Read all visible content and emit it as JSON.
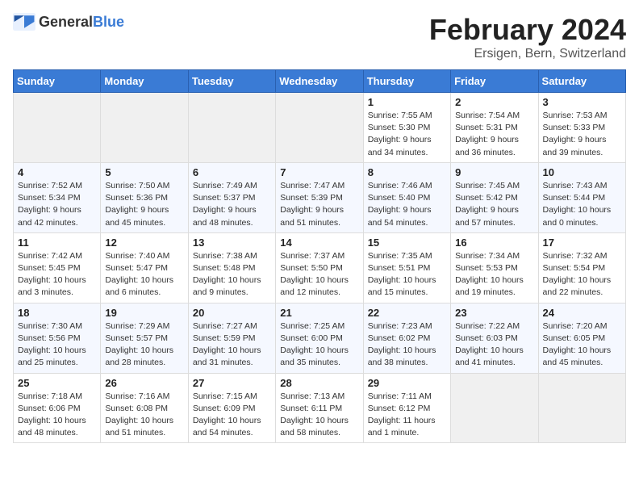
{
  "header": {
    "logo_general": "General",
    "logo_blue": "Blue",
    "month": "February 2024",
    "location": "Ersigen, Bern, Switzerland"
  },
  "weekdays": [
    "Sunday",
    "Monday",
    "Tuesday",
    "Wednesday",
    "Thursday",
    "Friday",
    "Saturday"
  ],
  "weeks": [
    [
      {
        "day": "",
        "info": ""
      },
      {
        "day": "",
        "info": ""
      },
      {
        "day": "",
        "info": ""
      },
      {
        "day": "",
        "info": ""
      },
      {
        "day": "1",
        "info": "Sunrise: 7:55 AM\nSunset: 5:30 PM\nDaylight: 9 hours and 34 minutes."
      },
      {
        "day": "2",
        "info": "Sunrise: 7:54 AM\nSunset: 5:31 PM\nDaylight: 9 hours and 36 minutes."
      },
      {
        "day": "3",
        "info": "Sunrise: 7:53 AM\nSunset: 5:33 PM\nDaylight: 9 hours and 39 minutes."
      }
    ],
    [
      {
        "day": "4",
        "info": "Sunrise: 7:52 AM\nSunset: 5:34 PM\nDaylight: 9 hours and 42 minutes."
      },
      {
        "day": "5",
        "info": "Sunrise: 7:50 AM\nSunset: 5:36 PM\nDaylight: 9 hours and 45 minutes."
      },
      {
        "day": "6",
        "info": "Sunrise: 7:49 AM\nSunset: 5:37 PM\nDaylight: 9 hours and 48 minutes."
      },
      {
        "day": "7",
        "info": "Sunrise: 7:47 AM\nSunset: 5:39 PM\nDaylight: 9 hours and 51 minutes."
      },
      {
        "day": "8",
        "info": "Sunrise: 7:46 AM\nSunset: 5:40 PM\nDaylight: 9 hours and 54 minutes."
      },
      {
        "day": "9",
        "info": "Sunrise: 7:45 AM\nSunset: 5:42 PM\nDaylight: 9 hours and 57 minutes."
      },
      {
        "day": "10",
        "info": "Sunrise: 7:43 AM\nSunset: 5:44 PM\nDaylight: 10 hours and 0 minutes."
      }
    ],
    [
      {
        "day": "11",
        "info": "Sunrise: 7:42 AM\nSunset: 5:45 PM\nDaylight: 10 hours and 3 minutes."
      },
      {
        "day": "12",
        "info": "Sunrise: 7:40 AM\nSunset: 5:47 PM\nDaylight: 10 hours and 6 minutes."
      },
      {
        "day": "13",
        "info": "Sunrise: 7:38 AM\nSunset: 5:48 PM\nDaylight: 10 hours and 9 minutes."
      },
      {
        "day": "14",
        "info": "Sunrise: 7:37 AM\nSunset: 5:50 PM\nDaylight: 10 hours and 12 minutes."
      },
      {
        "day": "15",
        "info": "Sunrise: 7:35 AM\nSunset: 5:51 PM\nDaylight: 10 hours and 15 minutes."
      },
      {
        "day": "16",
        "info": "Sunrise: 7:34 AM\nSunset: 5:53 PM\nDaylight: 10 hours and 19 minutes."
      },
      {
        "day": "17",
        "info": "Sunrise: 7:32 AM\nSunset: 5:54 PM\nDaylight: 10 hours and 22 minutes."
      }
    ],
    [
      {
        "day": "18",
        "info": "Sunrise: 7:30 AM\nSunset: 5:56 PM\nDaylight: 10 hours and 25 minutes."
      },
      {
        "day": "19",
        "info": "Sunrise: 7:29 AM\nSunset: 5:57 PM\nDaylight: 10 hours and 28 minutes."
      },
      {
        "day": "20",
        "info": "Sunrise: 7:27 AM\nSunset: 5:59 PM\nDaylight: 10 hours and 31 minutes."
      },
      {
        "day": "21",
        "info": "Sunrise: 7:25 AM\nSunset: 6:00 PM\nDaylight: 10 hours and 35 minutes."
      },
      {
        "day": "22",
        "info": "Sunrise: 7:23 AM\nSunset: 6:02 PM\nDaylight: 10 hours and 38 minutes."
      },
      {
        "day": "23",
        "info": "Sunrise: 7:22 AM\nSunset: 6:03 PM\nDaylight: 10 hours and 41 minutes."
      },
      {
        "day": "24",
        "info": "Sunrise: 7:20 AM\nSunset: 6:05 PM\nDaylight: 10 hours and 45 minutes."
      }
    ],
    [
      {
        "day": "25",
        "info": "Sunrise: 7:18 AM\nSunset: 6:06 PM\nDaylight: 10 hours and 48 minutes."
      },
      {
        "day": "26",
        "info": "Sunrise: 7:16 AM\nSunset: 6:08 PM\nDaylight: 10 hours and 51 minutes."
      },
      {
        "day": "27",
        "info": "Sunrise: 7:15 AM\nSunset: 6:09 PM\nDaylight: 10 hours and 54 minutes."
      },
      {
        "day": "28",
        "info": "Sunrise: 7:13 AM\nSunset: 6:11 PM\nDaylight: 10 hours and 58 minutes."
      },
      {
        "day": "29",
        "info": "Sunrise: 7:11 AM\nSunset: 6:12 PM\nDaylight: 11 hours and 1 minute."
      },
      {
        "day": "",
        "info": ""
      },
      {
        "day": "",
        "info": ""
      }
    ]
  ]
}
